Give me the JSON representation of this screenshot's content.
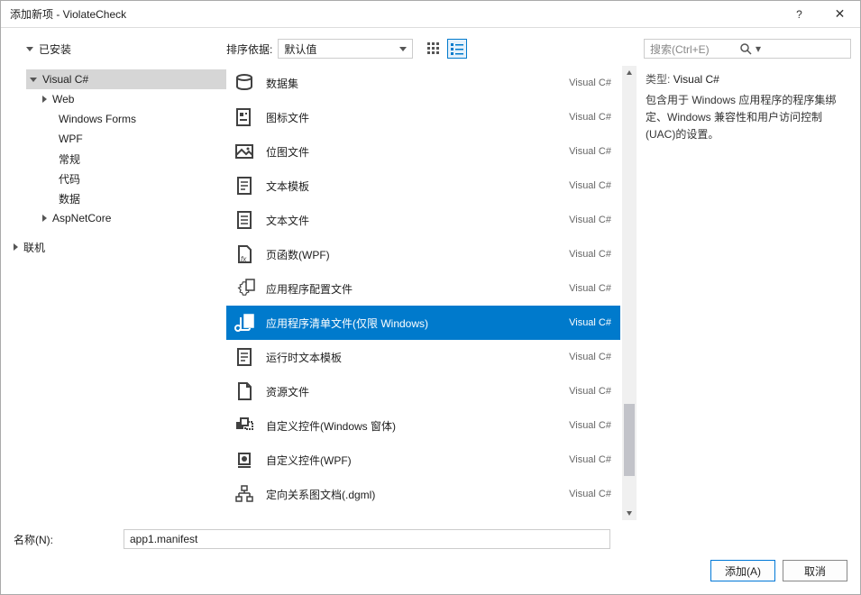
{
  "title": "添加新项 - ViolateCheck",
  "titlebar": {
    "help": "?",
    "close": "✕"
  },
  "tree": {
    "installed_label": "已安装",
    "nodes": [
      {
        "label": "Visual C#",
        "expanded": true,
        "selected": true,
        "level": 1,
        "children": [
          {
            "label": "Web",
            "level": 2,
            "caret": "right"
          },
          {
            "label": "Windows Forms",
            "level": 2
          },
          {
            "label": "WPF",
            "level": 2
          },
          {
            "label": "常规",
            "level": 2
          },
          {
            "label": "代码",
            "level": 2
          },
          {
            "label": "数据",
            "level": 2
          },
          {
            "label": "AspNetCore",
            "level": 2,
            "caret": "right"
          }
        ]
      },
      {
        "label": "联机",
        "level": 0,
        "caret": "right"
      }
    ]
  },
  "sort": {
    "label": "排序依据:",
    "selected": "默认值"
  },
  "search": {
    "placeholder": "搜索(Ctrl+E)"
  },
  "items": [
    {
      "icon": "dataset",
      "label": "数据集",
      "lang": "Visual C#"
    },
    {
      "icon": "iconfile",
      "label": "图标文件",
      "lang": "Visual C#"
    },
    {
      "icon": "bitmap",
      "label": "位图文件",
      "lang": "Visual C#"
    },
    {
      "icon": "template",
      "label": "文本模板",
      "lang": "Visual C#"
    },
    {
      "icon": "textfile",
      "label": "文本文件",
      "lang": "Visual C#"
    },
    {
      "icon": "pagefx",
      "label": "页函数(WPF)",
      "lang": "Visual C#"
    },
    {
      "icon": "config",
      "label": "应用程序配置文件",
      "lang": "Visual C#"
    },
    {
      "icon": "manifest",
      "label": "应用程序清单文件(仅限 Windows)",
      "lang": "Visual C#",
      "selected": true
    },
    {
      "icon": "template",
      "label": "运行时文本模板",
      "lang": "Visual C#"
    },
    {
      "icon": "resource",
      "label": "资源文件",
      "lang": "Visual C#"
    },
    {
      "icon": "usercontrol",
      "label": "自定义控件(Windows 窗体)",
      "lang": "Visual C#"
    },
    {
      "icon": "usercontrol-wpf",
      "label": "自定义控件(WPF)",
      "lang": "Visual C#"
    },
    {
      "icon": "dgml",
      "label": "定向关系图文档(.dgml)",
      "lang": "Visual C#"
    }
  ],
  "info": {
    "type_label": "类型:",
    "type_value": "Visual C#",
    "description": "包含用于 Windows 应用程序的程序集绑定、Windows 兼容性和用户访问控制(UAC)的设置。"
  },
  "name": {
    "label": "名称(N):",
    "value": "app1.manifest"
  },
  "buttons": {
    "add": "添加(A)",
    "cancel": "取消"
  }
}
